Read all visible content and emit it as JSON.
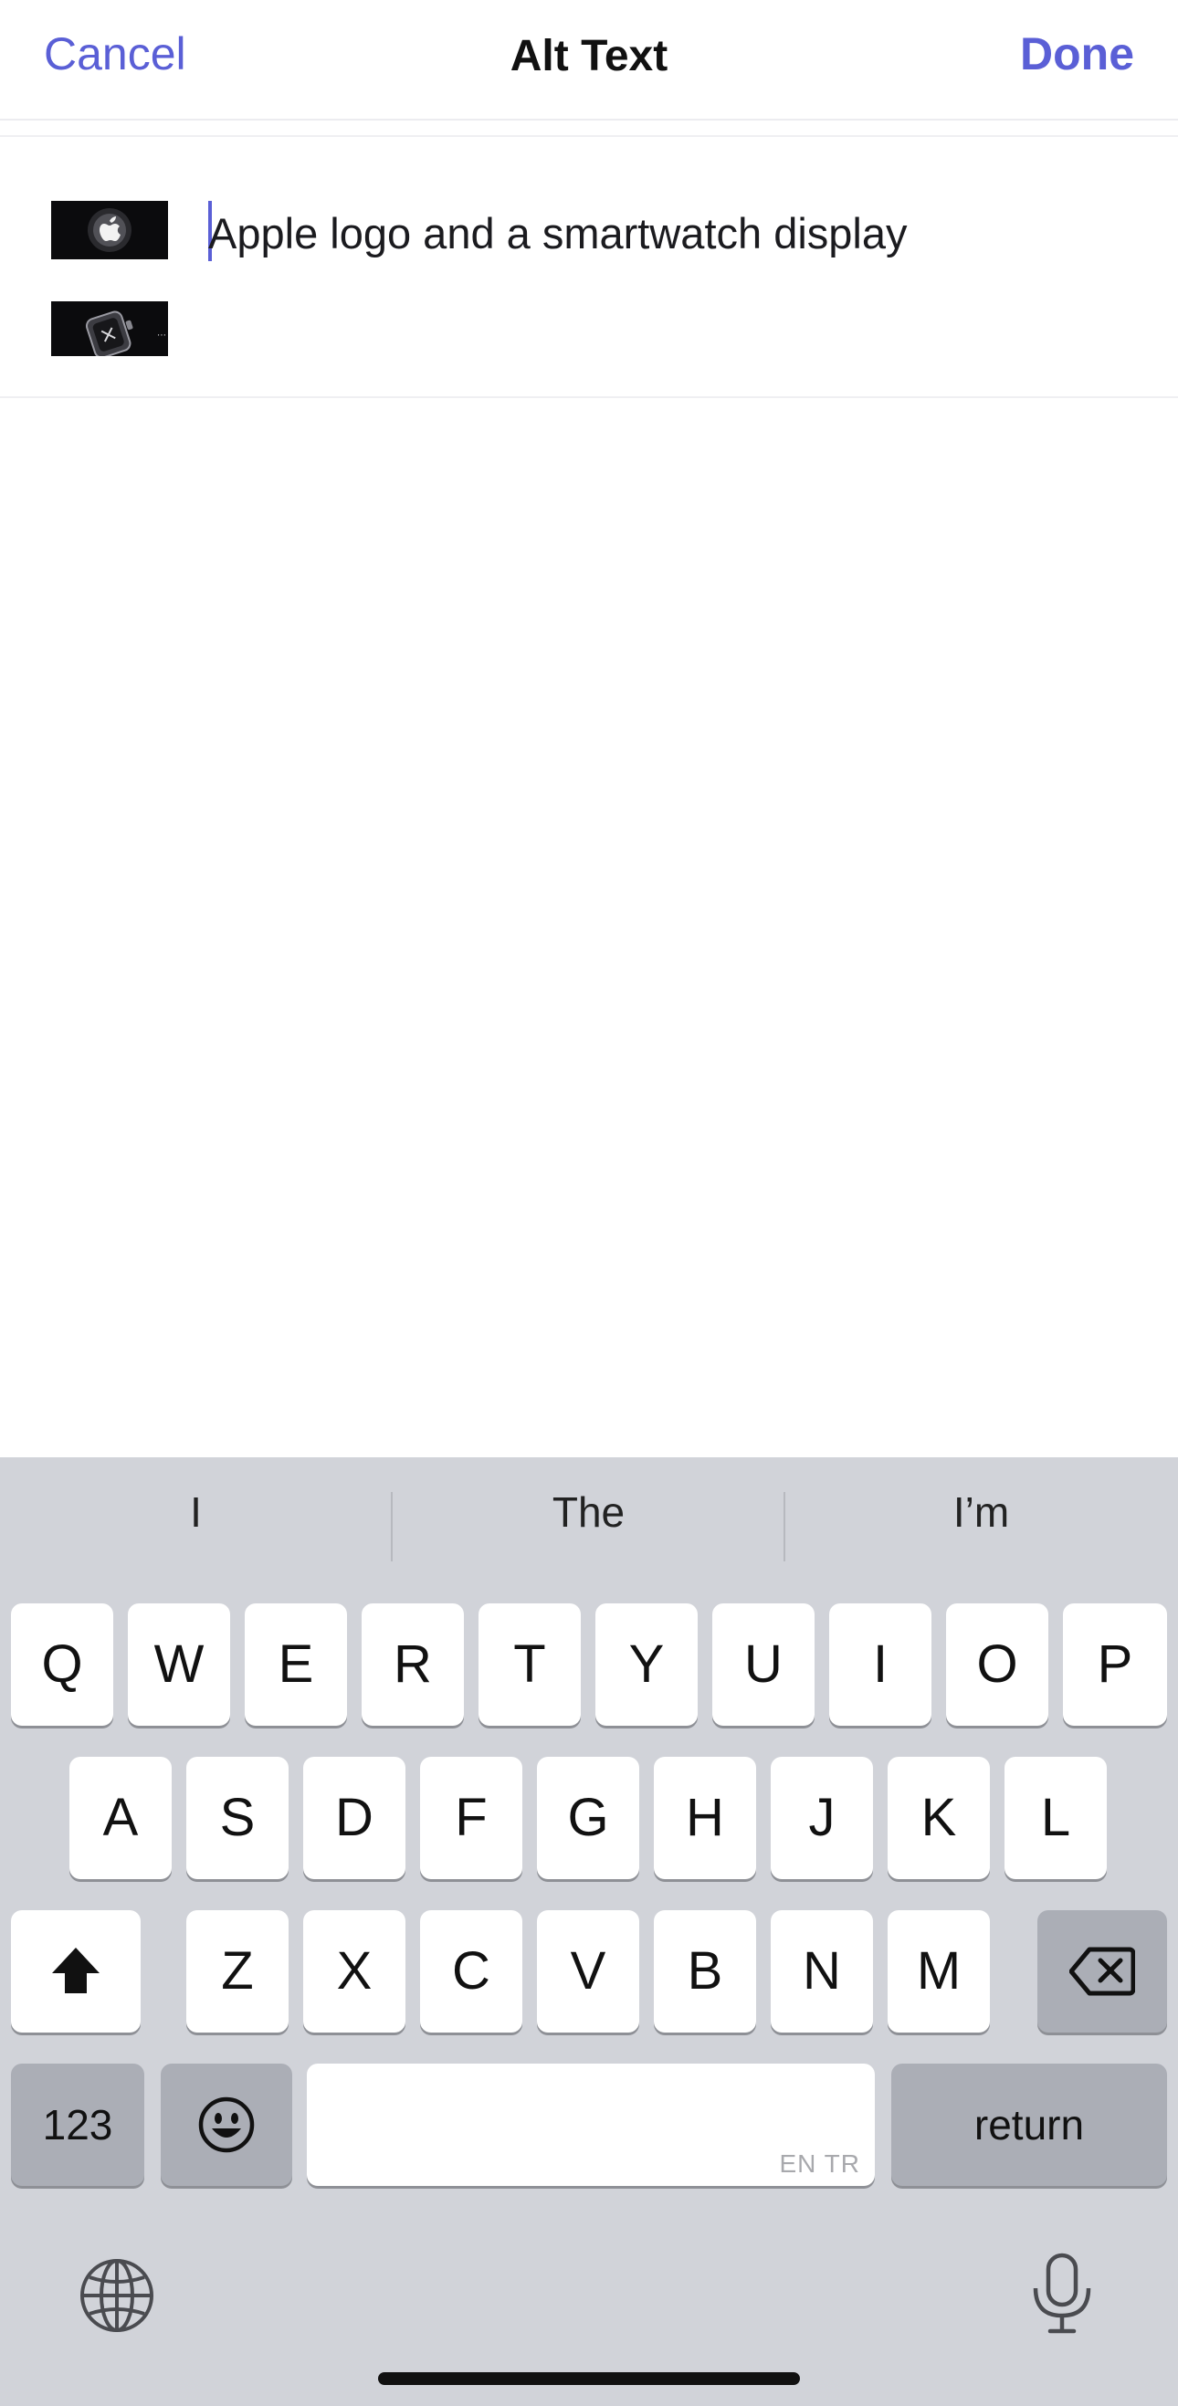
{
  "navbar": {
    "cancel_label": "Cancel",
    "title": "Alt Text",
    "done_label": "Done"
  },
  "editor": {
    "thumbnails": [
      {
        "caption": "Apple logo"
      },
      {
        "caption": "smartwatch"
      }
    ],
    "alt_text_value": "Apple logo and a smartwatch display"
  },
  "keyboard": {
    "predictions": [
      "I",
      "The",
      "I’m"
    ],
    "row1": [
      "Q",
      "W",
      "E",
      "R",
      "T",
      "Y",
      "U",
      "I",
      "O",
      "P"
    ],
    "row2": [
      "A",
      "S",
      "D",
      "F",
      "G",
      "H",
      "J",
      "K",
      "L"
    ],
    "row3": [
      "Z",
      "X",
      "C",
      "V",
      "B",
      "N",
      "M"
    ],
    "numbers_label": "123",
    "return_label": "return",
    "space_language_badge": "EN TR",
    "icons": {
      "shift": "shift-icon",
      "backspace": "backspace-icon",
      "emoji": "emoji-icon",
      "globe": "globe-icon",
      "microphone": "microphone-icon"
    }
  },
  "colors": {
    "accent": "#5a5fd6",
    "keyboard_bg": "#d1d3d9",
    "key_bg": "#ffffff",
    "dark_key_bg": "#abaeb6"
  }
}
